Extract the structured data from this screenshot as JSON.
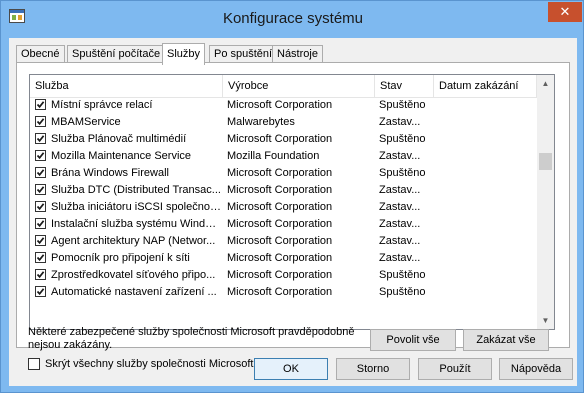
{
  "window": {
    "title": "Konfigurace systému",
    "close_glyph": "✕"
  },
  "tabs": [
    {
      "label": "Obecné"
    },
    {
      "label": "Spuštění počítače"
    },
    {
      "label": "Služby"
    },
    {
      "label": "Po spuštění"
    },
    {
      "label": "Nástroje"
    }
  ],
  "columns": {
    "service": "Služba",
    "vendor": "Výrobce",
    "status": "Stav",
    "disabled_date": "Datum zakázání"
  },
  "services": [
    {
      "checked": true,
      "name": "Místní správce relací",
      "vendor": "Microsoft Corporation",
      "status": "Spuštěno"
    },
    {
      "checked": true,
      "name": "MBAMService",
      "vendor": "Malwarebytes",
      "status": "Zastav..."
    },
    {
      "checked": true,
      "name": "Služba Plánovač multimédií",
      "vendor": "Microsoft Corporation",
      "status": "Spuštěno"
    },
    {
      "checked": true,
      "name": "Mozilla Maintenance Service",
      "vendor": "Mozilla Foundation",
      "status": "Zastav..."
    },
    {
      "checked": true,
      "name": "Brána Windows Firewall",
      "vendor": "Microsoft Corporation",
      "status": "Spuštěno"
    },
    {
      "checked": true,
      "name": "Služba DTC (Distributed Transac...",
      "vendor": "Microsoft Corporation",
      "status": "Zastav..."
    },
    {
      "checked": true,
      "name": "Služba iniciátoru iSCSI společnos...",
      "vendor": "Microsoft Corporation",
      "status": "Zastav..."
    },
    {
      "checked": true,
      "name": "Instalační služba systému Windows",
      "vendor": "Microsoft Corporation",
      "status": "Zastav..."
    },
    {
      "checked": true,
      "name": "Agent architektury NAP (Networ...",
      "vendor": "Microsoft Corporation",
      "status": "Zastav..."
    },
    {
      "checked": true,
      "name": "Pomocník pro připojení k síti",
      "vendor": "Microsoft Corporation",
      "status": "Zastav..."
    },
    {
      "checked": true,
      "name": "Zprostředkovatel síťového připo...",
      "vendor": "Microsoft Corporation",
      "status": "Spuštěno"
    },
    {
      "checked": true,
      "name": "Automatické nastavení zařízení ...",
      "vendor": "Microsoft Corporation",
      "status": "Spuštěno"
    }
  ],
  "note": "Některé zabezpečené služby společnosti Microsoft pravděpodobně nejsou zakázány.",
  "buttons": {
    "enable_all": "Povolit vše",
    "disable_all": "Zakázat vše",
    "ok": "OK",
    "cancel": "Storno",
    "apply": "Použít",
    "help": "Nápověda"
  },
  "hide_ms": {
    "label": "Skrýt všechny služby společnosti Microsoft",
    "checked": false
  },
  "scrollbar": {
    "up_glyph": "▲",
    "down_glyph": "▼",
    "position": 0.3
  },
  "colors": {
    "frame": "#7eb9f0",
    "close": "#c7502d",
    "face": "#f0f0f0"
  }
}
